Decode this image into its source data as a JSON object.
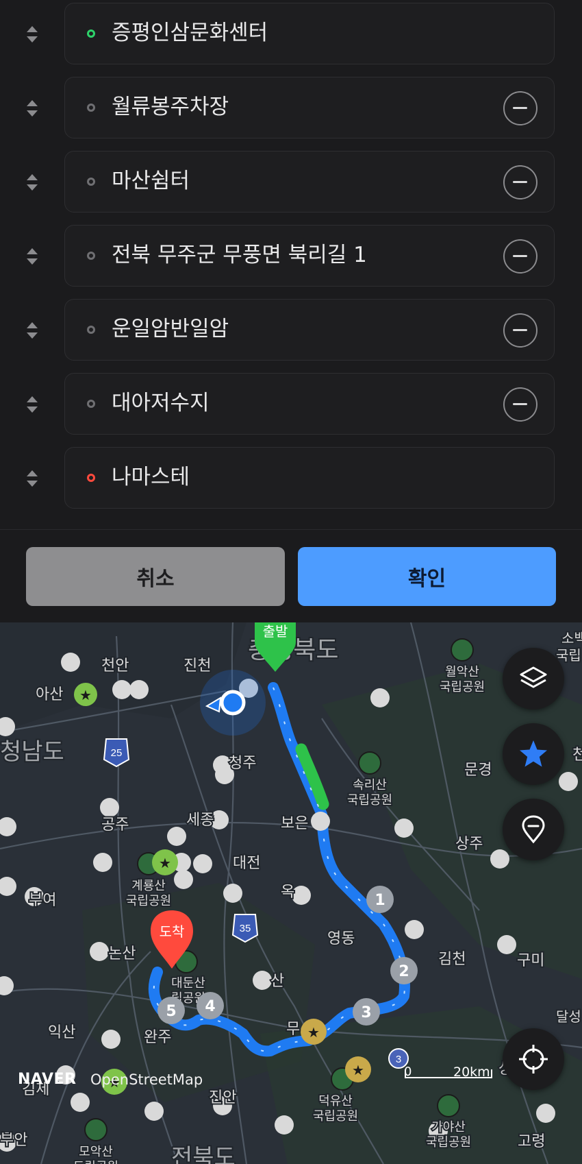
{
  "waypoints": [
    {
      "label": "증평인삼문화센터",
      "type": "start",
      "removable": false
    },
    {
      "label": "월류봉주차장",
      "type": "via",
      "removable": true
    },
    {
      "label": "마산쉼터",
      "type": "via",
      "removable": true
    },
    {
      "label": "전북 무주군 무풍면 북리길 1",
      "type": "via",
      "removable": true
    },
    {
      "label": "운일암반일암",
      "type": "via",
      "removable": true
    },
    {
      "label": "대아저수지",
      "type": "via",
      "removable": true
    },
    {
      "label": "나마스테",
      "type": "end",
      "removable": false
    }
  ],
  "buttons": {
    "cancel": "취소",
    "confirm": "확인"
  },
  "map": {
    "start_pin": "출발",
    "end_pin": "도착",
    "places": {
      "chungbuk": "충청북도",
      "jincheon": "진천",
      "cheonan": "천안",
      "asan": "아산",
      "chungnam": "청남도",
      "cheongju": "청주",
      "boeun": "보은",
      "mungyeong": "문경",
      "sangju": "상주",
      "gongju": "공주",
      "sejong": "세종",
      "daejeon": "대전",
      "okcheon": "옥",
      "buyeo": "부여",
      "yeongdong": "영동",
      "gimcheon": "김천",
      "gumi": "구미",
      "nonsan": "논산",
      "geumsan": "산",
      "iksan": "익산",
      "wanju": "완주",
      "gimje": "김제",
      "jinan": "진안",
      "goryeong": "고령",
      "muju": "무",
      "jeonbuk": "전북도",
      "buan": "부안",
      "sobaek": "소백",
      "gungnip": "국립",
      "dalseong": "달성",
      "sang": "상",
      "jeon": "천"
    },
    "parks": {
      "woraksan": "월악산\n국립공원",
      "songnisan": "속리산\n국립공원",
      "gyeryongsan": "계룡산\n국립공원",
      "daedunsan": "대둔산\n립공원",
      "deogyusan": "덕유산\n국립공원",
      "moaksan": "모악산\n도립공원",
      "gayasan": "가야산\n국립공원"
    },
    "route_markers": [
      "1",
      "2",
      "3",
      "4",
      "5"
    ],
    "highways": [
      "25",
      "35",
      "3"
    ],
    "scale": {
      "zero": "0",
      "label": "20km"
    },
    "credits": {
      "naver": "NAVER",
      "osm": "OpenStreetMap"
    }
  }
}
